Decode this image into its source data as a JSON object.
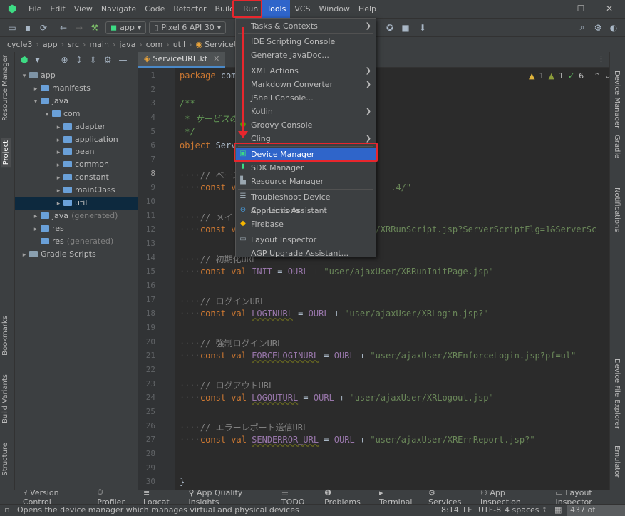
{
  "menubar": {
    "items": [
      "File",
      "Edit",
      "View",
      "Navigate",
      "Code",
      "Refactor",
      "Build",
      "Run",
      "Tools",
      "VCS",
      "Window",
      "Help"
    ]
  },
  "toolbar": {
    "module": "app",
    "device": "Pixel 6 API 30"
  },
  "breadcrumb": [
    "cycle3",
    "app",
    "src",
    "main",
    "java",
    "com",
    "util",
    "ServiceURL"
  ],
  "left_tabs": [
    "Resource Manager",
    "Project",
    "Bookmarks",
    "Build Variants",
    "Structure"
  ],
  "right_tabs": [
    "Device Manager",
    "Gradle",
    "Notifications",
    "Device File Explorer",
    "Emulator"
  ],
  "tree": [
    {
      "label": "app",
      "indent": 0,
      "arrow": "▾",
      "type": "mod"
    },
    {
      "label": "manifests",
      "indent": 1,
      "arrow": "▸",
      "type": "folder"
    },
    {
      "label": "java",
      "indent": 1,
      "arrow": "▾",
      "type": "folder"
    },
    {
      "label": "com",
      "indent": 2,
      "arrow": "▾",
      "type": "folder"
    },
    {
      "label": "adapter",
      "indent": 3,
      "arrow": "▸",
      "type": "folder"
    },
    {
      "label": "application",
      "indent": 3,
      "arrow": "▸",
      "type": "folder"
    },
    {
      "label": "bean",
      "indent": 3,
      "arrow": "▸",
      "type": "folder"
    },
    {
      "label": "common",
      "indent": 3,
      "arrow": "▸",
      "type": "folder"
    },
    {
      "label": "constant",
      "indent": 3,
      "arrow": "▸",
      "type": "folder"
    },
    {
      "label": "mainClass",
      "indent": 3,
      "arrow": "▸",
      "type": "folder"
    },
    {
      "label": "util",
      "indent": 3,
      "arrow": "▸",
      "type": "folder",
      "selected": true
    },
    {
      "label": "java",
      "suffix": "(generated)",
      "indent": 1,
      "arrow": "▸",
      "type": "folder"
    },
    {
      "label": "res",
      "indent": 1,
      "arrow": "▸",
      "type": "folder"
    },
    {
      "label": "res",
      "suffix": "(generated)",
      "indent": 1,
      "arrow": "",
      "type": "folder"
    },
    {
      "label": "Gradle Scripts",
      "indent": 0,
      "arrow": "▸",
      "type": "gradle"
    }
  ],
  "editor": {
    "tab": "ServiceURL.kt",
    "inspections": {
      "warnings": "1",
      "weak": "1",
      "ok": "6"
    },
    "current_line": "8",
    "lines": [
      {
        "n": "1",
        "html": "<span class='kw'>package</span> com"
      },
      {
        "n": "2",
        "html": ""
      },
      {
        "n": "3",
        "html": "<span class='doc'>/**</span>"
      },
      {
        "n": "4",
        "html": "<span class='doc'> * サービスの                    ェクト</span>"
      },
      {
        "n": "5",
        "html": "<span class='doc'> */</span>"
      },
      {
        "n": "6",
        "html": "<span class='kw'>object</span> Serv"
      },
      {
        "n": "7",
        "html": ""
      },
      {
        "n": "8",
        "html": "<span class='dot'>····</span><span class='cmt'>// ベース</span>"
      },
      {
        "n": "9",
        "html": "<span class='dot'>····</span><span class='kw'>const v</span>                              <span class='str'>.4/\"</span>"
      },
      {
        "n": "10",
        "html": ""
      },
      {
        "n": "11",
        "html": "<span class='dot'>····</span><span class='cmt'>// メイ</span>"
      },
      {
        "n": "12",
        "html": "<span class='dot'>····</span><span class='kw'>const v</span>                       <span class='str'>User/XRRunScript.jsp?ServerScriptFlg=1&amp;ServerSc</span>"
      },
      {
        "n": "13",
        "html": ""
      },
      {
        "n": "14",
        "html": "<span class='dot'>····</span><span class='cmt'>// 初期化URL</span>"
      },
      {
        "n": "15",
        "html": "<span class='dot'>····</span><span class='kw'>const val </span><span class='cst'>INIT</span> = <span class='cst'>OURL</span> + <span class='str'>\"user/ajaxUser/XRRunInitPage.jsp\"</span>"
      },
      {
        "n": "16",
        "html": ""
      },
      {
        "n": "17",
        "html": "<span class='dot'>····</span><span class='cmt'>// ログインURL</span>"
      },
      {
        "n": "18",
        "html": "<span class='dot'>····</span><span class='kw'>const val </span><span class='cst ul'>LOGINURL</span> = <span class='cst'>OURL</span> + <span class='str'>\"user/ajaxUser/XRLogin.jsp?\"</span>"
      },
      {
        "n": "19",
        "html": ""
      },
      {
        "n": "20",
        "html": "<span class='dot'>····</span><span class='cmt'>// 強制ログインURL</span>"
      },
      {
        "n": "21",
        "html": "<span class='dot'>····</span><span class='kw'>const val </span><span class='cst ul'>FORCELOGINURL</span> = <span class='cst'>OURL</span> + <span class='str'>\"user/ajaxUser/XREnforceLogin.jsp?pf=ul\"</span>"
      },
      {
        "n": "22",
        "html": ""
      },
      {
        "n": "23",
        "html": "<span class='dot'>····</span><span class='cmt'>// ログアウトURL</span>"
      },
      {
        "n": "24",
        "html": "<span class='dot'>····</span><span class='kw'>const val </span><span class='cst ul'>LOGOUTURL</span> = <span class='cst'>OURL</span> + <span class='str'>\"user/ajaxUser/XRLogout.jsp\"</span>"
      },
      {
        "n": "25",
        "html": ""
      },
      {
        "n": "26",
        "html": "<span class='dot'>····</span><span class='cmt'>// エラーレポート送信URL</span>"
      },
      {
        "n": "27",
        "html": "<span class='dot'>····</span><span class='kw'>const val </span><span class='cst ul'>SENDERROR_URL</span> = <span class='cst'>OURL</span> + <span class='str'>\"user/ajaxUser/XRErrReport.jsp?\"</span>"
      },
      {
        "n": "28",
        "html": ""
      },
      {
        "n": "29",
        "html": ""
      },
      {
        "n": "30",
        "html": "}"
      }
    ]
  },
  "tools_menu": {
    "items": [
      {
        "label": "Tasks & Contexts",
        "sub": true,
        "icon": ""
      },
      {
        "sep": true
      },
      {
        "label": "IDE Scripting Console",
        "icon": ""
      },
      {
        "label": "Generate JavaDoc...",
        "icon": ""
      },
      {
        "sep": true
      },
      {
        "label": "XML Actions",
        "sub": true,
        "icon": ""
      },
      {
        "label": "Markdown Converter",
        "sub": true,
        "icon": ""
      },
      {
        "label": "JShell Console...",
        "icon": ""
      },
      {
        "label": "Kotlin",
        "sub": true,
        "icon": ""
      },
      {
        "label": "Groovy Console",
        "icon": "●",
        "iconColor": "#4e9a06"
      },
      {
        "label": "Cling",
        "sub": true,
        "icon": ""
      },
      {
        "sep": true
      },
      {
        "label": "Device Manager",
        "icon": "▣",
        "iconColor": "#3ddc84",
        "highlight": true
      },
      {
        "label": "SDK Manager",
        "icon": "⬇",
        "iconColor": "#3ddc84"
      },
      {
        "label": "Resource Manager",
        "icon": "▙",
        "iconColor": "#9aa7b0"
      },
      {
        "sep": true
      },
      {
        "label": "Troubleshoot Device Connections",
        "icon": "☰",
        "iconColor": "#9aa7b0"
      },
      {
        "label": "App Links Assistant",
        "icon": "⊖",
        "iconColor": "#4a9fe0"
      },
      {
        "label": "Firebase",
        "icon": "◆",
        "iconColor": "#f6b600"
      },
      {
        "sep": true
      },
      {
        "label": "Layout Inspector",
        "icon": "▭",
        "iconColor": "#9aa7b0"
      },
      {
        "label": "AGP Upgrade Assistant...",
        "icon": ""
      }
    ]
  },
  "bottom_tools": [
    "Version Control",
    "Profiler",
    "Logcat",
    "App Quality Insights",
    "TODO",
    "Problems",
    "Terminal",
    "Services",
    "App Inspection",
    "Layout Inspector"
  ],
  "status": {
    "message": "Opens the device manager which manages virtual and physical devices",
    "position": "8:14",
    "line_sep": "LF",
    "encoding": "UTF-8",
    "indent": "4 spaces",
    "memory": "437 of 4096M"
  },
  "colors": {
    "highlight": "#2f65ca",
    "annotation": "#e8262d"
  }
}
